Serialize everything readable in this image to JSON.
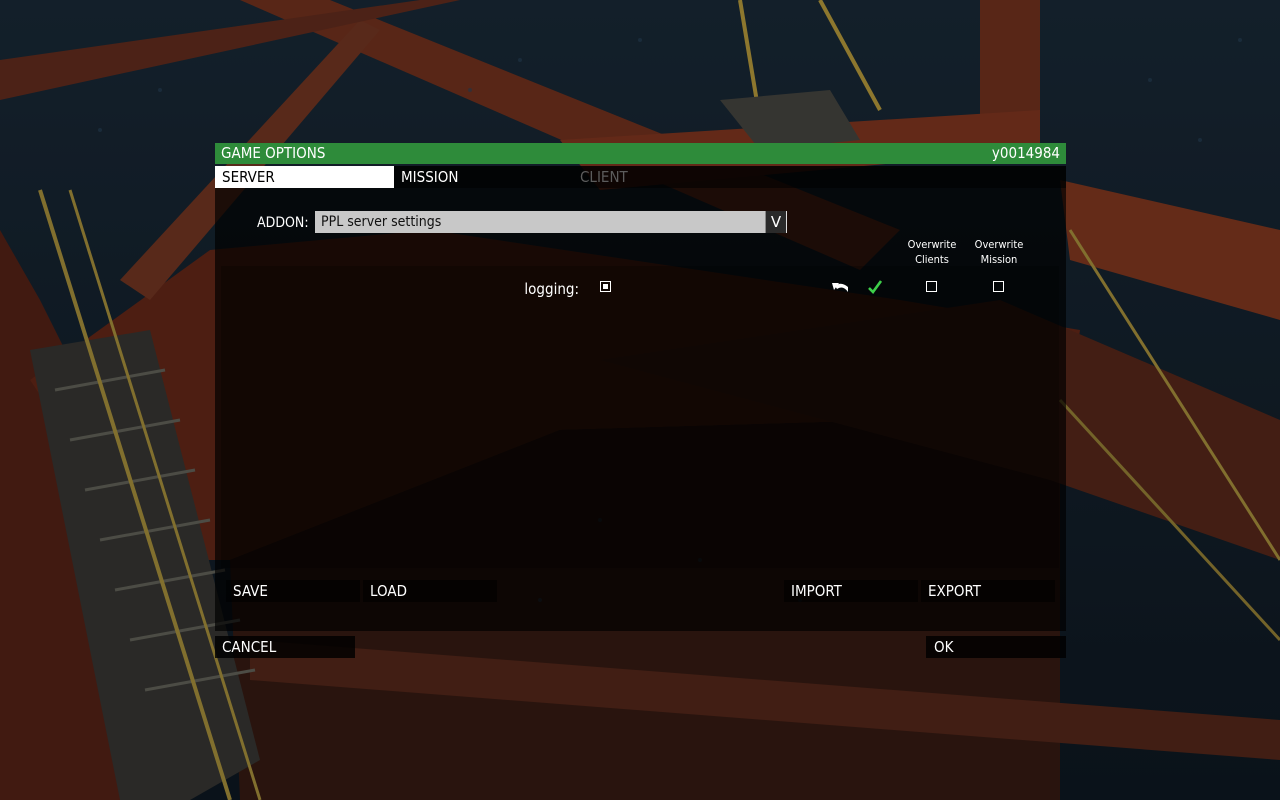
{
  "dialog": {
    "title": "GAME OPTIONS",
    "user_id": "y0014984",
    "accent_color": "#2e8b3a"
  },
  "tabs": [
    {
      "label": "SERVER",
      "state": "active"
    },
    {
      "label": "MISSION",
      "state": "normal"
    },
    {
      "label": "CLIENT",
      "state": "disabled"
    }
  ],
  "addon": {
    "label": "ADDON:",
    "selected": "PPL server settings",
    "arrow": "V"
  },
  "columns": {
    "overwrite_clients": "Overwrite\nClients",
    "overwrite_mission": "Overwrite\nMission"
  },
  "settings": [
    {
      "label": "logging:",
      "checked": true,
      "overwrite_clients": false,
      "overwrite_mission": false,
      "icons": [
        "undo-icon",
        "checkmark-icon"
      ]
    }
  ],
  "buttons": {
    "save": "SAVE",
    "load": "LOAD",
    "import": "IMPORT",
    "export": "EXPORT",
    "cancel": "CANCEL",
    "ok": "OK"
  }
}
